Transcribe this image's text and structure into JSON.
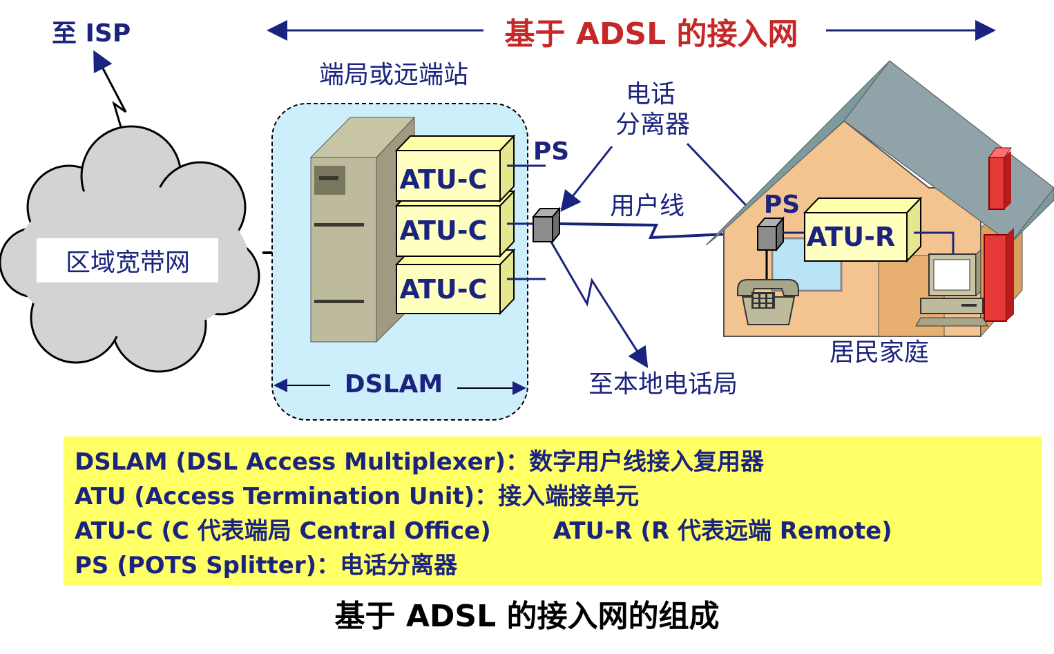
{
  "labels": {
    "to_isp": "至 ISP",
    "network_title": "基于 ADSL 的接入网",
    "central_office": "端局或远端站",
    "regional_network": "区域宽带网",
    "atu_c": "ATU-C",
    "ps_top": "PS",
    "ps_home": "PS",
    "splitter_line1": "电话",
    "splitter_line2": "分离器",
    "user_line": "用户线",
    "to_local_exchange": "至本地电话局",
    "dslam": "DSLAM",
    "atu_r": "ATU-R",
    "residence": "居民家庭"
  },
  "legend": {
    "dslam_line": "DSLAM (DSL Access Multiplexer)：数字用户线接入复用器",
    "atu_line": "ATU (Access Termination Unit)：接入端接单元",
    "atu_c_line": "ATU-C (C 代表端局 Central Office)",
    "atu_r_line": "ATU-R (R 代表远端 Remote)",
    "ps_line": "PS (POTS Splitter)：电话分离器"
  },
  "caption": "基于 ADSL 的接入网的组成",
  "colors": {
    "blue": "#1a237e",
    "red": "#c62828",
    "atu_fill": "#ffffc0",
    "dslam_bg": "#cdeefb",
    "legend_bg": "#ffff66",
    "house_wall": "#f3c48f",
    "roof": "#8fa3a8"
  }
}
